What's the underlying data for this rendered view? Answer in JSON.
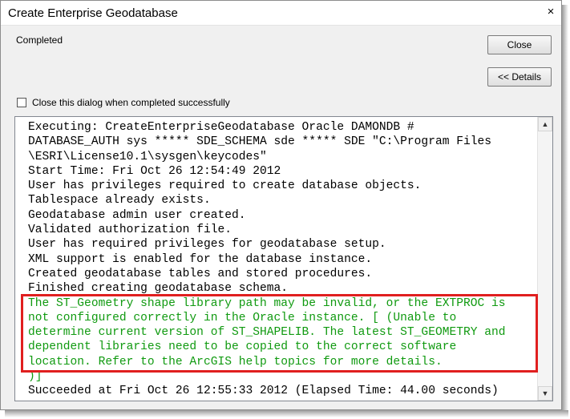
{
  "window": {
    "title": "Create Enterprise Geodatabase",
    "close_glyph": "×",
    "status": "Completed"
  },
  "buttons": {
    "close_label": "Close",
    "details_label": "<< Details"
  },
  "checkbox": {
    "label": "Close this dialog when completed successfully",
    "checked": false
  },
  "log": {
    "lines": [
      "Executing: CreateEnterpriseGeodatabase Oracle DAMONDB #",
      "DATABASE_AUTH sys ***** SDE_SCHEMA sde ***** SDE \"C:\\Program Files",
      "\\ESRI\\License10.1\\sysgen\\keycodes\"",
      "Start Time: Fri Oct 26 12:54:49 2012",
      "User has privileges required to create database objects.",
      "Tablespace already exists.",
      "Geodatabase admin user created.",
      "Validated authorization file.",
      "User has required privileges for geodatabase setup.",
      "XML support is enabled for the database instance.",
      "Created geodatabase tables and stored procedures.",
      "Finished creating geodatabase schema."
    ],
    "warning_lines": [
      "The ST_Geometry shape library path may be invalid, or the EXTPROC is",
      "not configured correctly in the Oracle instance. [ (Unable to",
      "determine current version of ST_SHAPELIB. The latest ST_GEOMETRY and",
      "dependent libraries need to be copied to the correct software",
      "location. Refer to the ArcGIS help topics for more details.",
      ")]"
    ],
    "final_line": "Succeeded at Fri Oct 26 12:55:33 2012 (Elapsed Time: 44.00 seconds)"
  },
  "colors": {
    "warning_text": "#109a10",
    "highlight_border": "#e01f1f"
  },
  "icons": {
    "close": "close-icon",
    "scroll_up": "scroll-up-arrow-icon",
    "scroll_down": "scroll-down-arrow-icon"
  }
}
